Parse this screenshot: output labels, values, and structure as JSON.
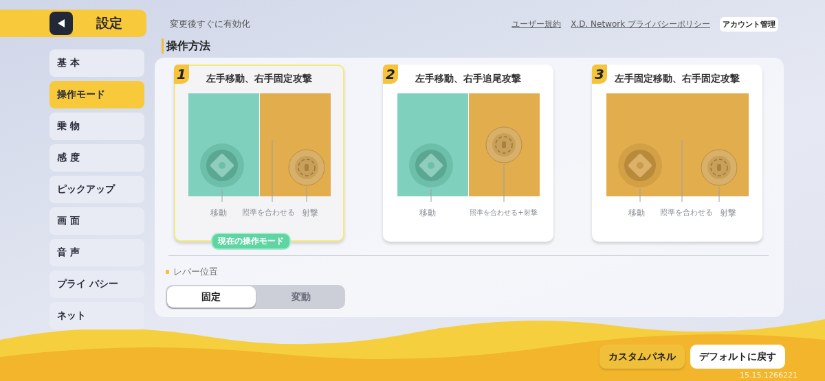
{
  "header": {
    "title": "設定"
  },
  "sidebar": {
    "items": [
      {
        "label": "基 本",
        "selected": false
      },
      {
        "label": "操作モード",
        "selected": true
      },
      {
        "label": "乗 物",
        "selected": false
      },
      {
        "label": "感 度",
        "selected": false
      },
      {
        "label": "ピックアップ",
        "selected": false
      },
      {
        "label": "画 面",
        "selected": false
      },
      {
        "label": "音 声",
        "selected": false
      },
      {
        "label": "プライ バシー",
        "selected": false
      },
      {
        "label": "ネット",
        "selected": false
      }
    ]
  },
  "notice": "変更後すぐに有効化",
  "top_links": [
    {
      "label": "ユーザー規約",
      "kind": "link"
    },
    {
      "label": "X.D. Network プライバシーポリシー",
      "kind": "link"
    },
    {
      "label": "アカウント管理",
      "kind": "button"
    }
  ],
  "section_title": "操作方法",
  "modes": [
    {
      "number": "1",
      "title": "左手移動、右手固定攻撃",
      "kind": "split-fixed",
      "selected": true,
      "badge": "現在の操作モード",
      "labels": [
        {
          "text": "移動",
          "kind": "move"
        },
        {
          "text": "照準を合わせる",
          "kind": "aim"
        },
        {
          "text": "射撃",
          "kind": "fire"
        }
      ]
    },
    {
      "number": "2",
      "title": "左手移動、右手追尾攻撃",
      "kind": "split-follow",
      "selected": false,
      "labels": [
        {
          "text": "移動",
          "kind": "move"
        },
        {
          "text": "照準を合わせる+射撃",
          "kind": "aim-fire"
        }
      ]
    },
    {
      "number": "3",
      "title": "左手固定移動、右手固定攻撃",
      "kind": "full-fixed",
      "selected": false,
      "labels": [
        {
          "text": "移動",
          "kind": "move"
        },
        {
          "text": "照準を合わせる",
          "kind": "aim"
        },
        {
          "text": "射撃",
          "kind": "fire"
        }
      ]
    }
  ],
  "lever": {
    "label": "レバー位置",
    "options": [
      {
        "label": "固定",
        "selected": true
      },
      {
        "label": "変動",
        "selected": false
      }
    ]
  },
  "buttons": [
    {
      "label": "カスタムパネル",
      "kind": "primary"
    },
    {
      "label": "デフォルトに戻す",
      "kind": "secondary"
    }
  ],
  "version": "15.15.1266221"
}
